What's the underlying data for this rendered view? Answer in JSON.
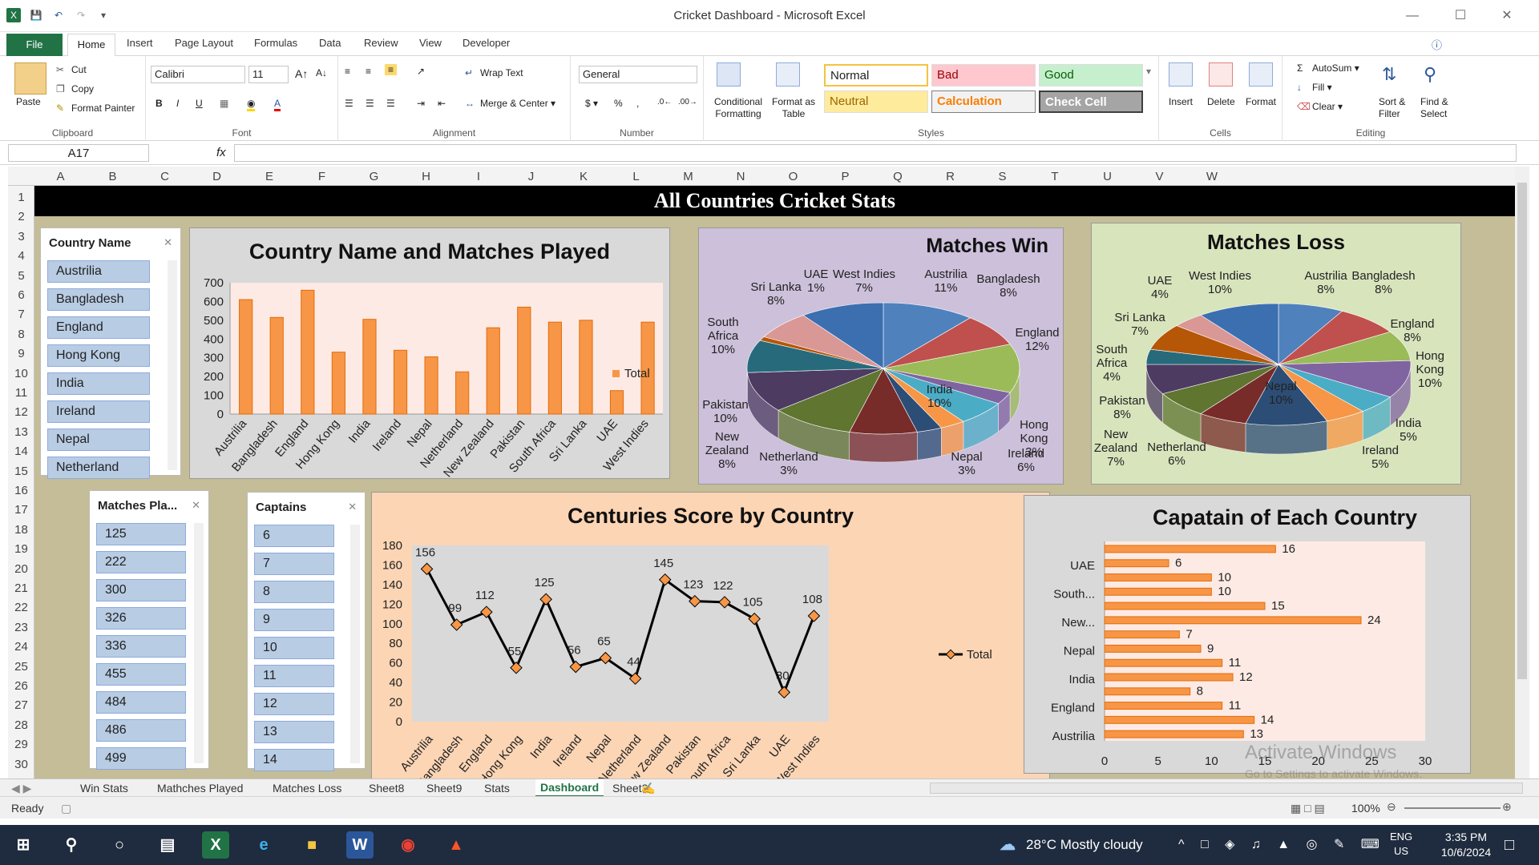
{
  "window": {
    "title": "Cricket Dashboard  -  Microsoft Excel"
  },
  "ribbon_tabs": [
    "File",
    "Home",
    "Insert",
    "Page Layout",
    "Formulas",
    "Data",
    "Review",
    "View",
    "Developer"
  ],
  "clipboard": {
    "paste": "Paste",
    "cut": "Cut",
    "copy": "Copy",
    "format_painter": "Format Painter",
    "label": "Clipboard"
  },
  "font": {
    "name": "Calibri",
    "size": "11",
    "label": "Font"
  },
  "alignment": {
    "wrap": "Wrap Text",
    "merge": "Merge & Center",
    "label": "Alignment"
  },
  "number": {
    "format": "General",
    "label": "Number"
  },
  "styles": {
    "conditional": "Conditional Formatting",
    "format_table": "Format as Table",
    "normal": "Normal",
    "bad": "Bad",
    "good": "Good",
    "neutral": "Neutral",
    "calculation": "Calculation",
    "check_cell": "Check Cell",
    "label": "Styles"
  },
  "cells": {
    "insert": "Insert",
    "delete": "Delete",
    "format": "Format",
    "label": "Cells"
  },
  "editing": {
    "autosum": "AutoSum",
    "fill": "Fill",
    "clear": "Clear",
    "sort": "Sort & Filter",
    "find": "Find & Select",
    "label": "Editing"
  },
  "formula_bar": {
    "name_box": "A17",
    "fx": "fx",
    "value": ""
  },
  "columns": [
    "A",
    "B",
    "C",
    "D",
    "E",
    "F",
    "G",
    "H",
    "I",
    "J",
    "K",
    "L",
    "M",
    "N",
    "O",
    "P",
    "Q",
    "R",
    "S",
    "T",
    "U",
    "V",
    "W"
  ],
  "rows": [
    "1",
    "2",
    "3",
    "4",
    "5",
    "6",
    "7",
    "8",
    "9",
    "10",
    "11",
    "12",
    "13",
    "14",
    "15",
    "16",
    "17",
    "18",
    "19",
    "20",
    "21",
    "22",
    "23",
    "24",
    "25",
    "26",
    "27",
    "28",
    "29",
    "30"
  ],
  "dashboard": {
    "banner": "All Countries Cricket Stats",
    "slicer_country": {
      "title": "Country Name",
      "items": [
        "Austrilia",
        "Bangladesh",
        "England",
        "Hong Kong",
        "India",
        "Ireland",
        "Nepal",
        "Netherland"
      ]
    },
    "slicer_matches": {
      "title": "Matches Pla...",
      "items": [
        "125",
        "222",
        "300",
        "326",
        "336",
        "455",
        "484",
        "486",
        "499"
      ]
    },
    "slicer_captains": {
      "title": "Captains",
      "items": [
        "6",
        "7",
        "8",
        "9",
        "10",
        "11",
        "12",
        "13",
        "14"
      ]
    },
    "chart1_title": "Country Name and Matches Played",
    "chart2_title": "Matches  Win",
    "chart3_title": "Matches Loss",
    "chart4_title": "Centuries Score by Country",
    "chart5_title": "Capatain of Each Country",
    "legend_total": "Total"
  },
  "chart_data": [
    {
      "type": "bar",
      "title": "Country Name and Matches Played",
      "categories": [
        "Austrilia",
        "Bangladesh",
        "England",
        "Hong Kong",
        "India",
        "Ireland",
        "Nepal",
        "Netherland",
        "New Zealand",
        "Pakistan",
        "South Africa",
        "Sri Lanka",
        "UAE",
        "West Indies"
      ],
      "series": [
        {
          "name": "Total",
          "values": [
            610,
            515,
            660,
            330,
            505,
            340,
            305,
            225,
            460,
            570,
            490,
            500,
            125,
            490
          ]
        }
      ],
      "yticks": [
        "0",
        "100",
        "200",
        "300",
        "400",
        "500",
        "600",
        "700"
      ],
      "ylim": [
        0,
        700
      ]
    },
    {
      "type": "pie",
      "title": "Matches  Win",
      "labels": [
        "Austrilia",
        "Bangladesh",
        "England",
        "Hong Kong",
        "Ireland",
        "Nepal",
        "Netherland",
        "New Zealand",
        "Pakistan",
        "South Africa",
        "Sri Lanka",
        "UAE",
        "West Indies",
        "India"
      ],
      "values": [
        11,
        8,
        12,
        3,
        6,
        3,
        3,
        8,
        10,
        10,
        8,
        1,
        7,
        10
      ],
      "data_labels": [
        "Austrilia 11%",
        "Bangladesh 8%",
        "England 12%",
        "Hong Kong 3%",
        "Ireland 6%",
        "Nepal 3%",
        "Netherland 3%",
        "New Zealand 8%",
        "Pakistan 10%",
        "South Africa 10%",
        "Sri Lanka 8%",
        "UAE 1%",
        "West Indies 7%",
        "India 10%"
      ]
    },
    {
      "type": "pie",
      "title": "Matches Loss",
      "labels": [
        "Austrilia",
        "Bangladesh",
        "England",
        "Hong Kong",
        "India",
        "Ireland",
        "Nepal",
        "Netherland",
        "New Zealand",
        "Pakistan",
        "South Africa",
        "Sri Lanka",
        "UAE",
        "West Indies"
      ],
      "values": [
        8,
        8,
        8,
        10,
        5,
        5,
        10,
        6,
        7,
        8,
        4,
        7,
        4,
        10
      ],
      "data_labels": [
        "Austrilia 8%",
        "Bangladesh 8%",
        "England 8%",
        "Hong Kong 10%",
        "India 5%",
        "Ireland 5%",
        "Nepal 10%",
        "Netherland 6%",
        "New Zealand 7%",
        "Pakistan 8%",
        "South Africa 4%",
        "Sri Lanka 7%",
        "UAE 4%",
        "West Indies 10%"
      ]
    },
    {
      "type": "line",
      "title": "Centuries Score by Country",
      "categories": [
        "Austrilia",
        "Bangladesh",
        "England",
        "Hong Kong",
        "India",
        "Ireland",
        "Nepal",
        "Netherland",
        "New Zealand",
        "Pakistan",
        "South Africa",
        "Sri Lanka",
        "UAE",
        "West Indies"
      ],
      "series": [
        {
          "name": "Total",
          "values": [
            156,
            99,
            112,
            55,
            125,
            56,
            65,
            44,
            145,
            123,
            122,
            105,
            30,
            108
          ]
        }
      ],
      "yticks": [
        "0",
        "20",
        "40",
        "60",
        "80",
        "100",
        "120",
        "140",
        "160",
        "180"
      ],
      "ylim": [
        0,
        180
      ]
    },
    {
      "type": "bar",
      "orientation": "horizontal",
      "title": "Capatain of Each Country",
      "categories": [
        "Austrilia",
        "",
        "England",
        "",
        "India",
        "",
        "Nepal",
        "",
        "New...",
        "",
        "South...",
        "",
        "UAE",
        ""
      ],
      "values": [
        13,
        14,
        11,
        8,
        12,
        11,
        9,
        7,
        24,
        15,
        10,
        10,
        6,
        16
      ],
      "xticks": [
        "0",
        "5",
        "10",
        "15",
        "20",
        "25",
        "30"
      ],
      "xlim": [
        0,
        30
      ]
    }
  ],
  "sheet_tabs": [
    "Win Stats",
    "Mathches Played",
    "Matches Loss",
    "Sheet8",
    "Sheet9",
    "Stats",
    "Dashboard",
    "Sheet3"
  ],
  "status": {
    "ready": "Ready",
    "zoom": "100%"
  },
  "watermark": {
    "line1": "Activate Windows",
    "line2": "Go to Settings to activate Windows."
  },
  "taskbar": {
    "weather": "28°C  Mostly cloudy",
    "lang1": "ENG",
    "lang2": "US",
    "time": "3:35 PM",
    "date": "10/6/2024"
  },
  "colors": {
    "accent": "#217346",
    "bar": "#f79646",
    "sheet_bg": "#c4bd97"
  }
}
